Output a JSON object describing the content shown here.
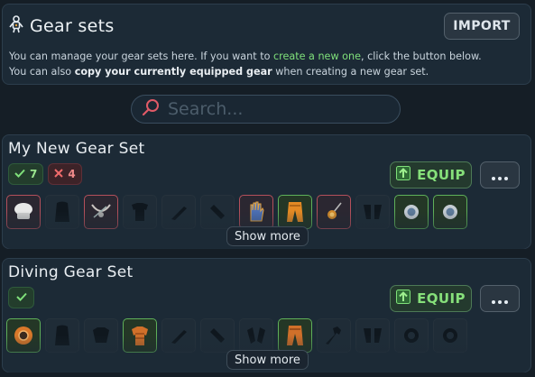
{
  "header": {
    "title": "Gear sets",
    "import_label": "IMPORT",
    "desc_line1_a": "You can manage your gear sets here. If you want to ",
    "desc_line1_link": "create a new one",
    "desc_line1_b": ", click the button below.",
    "desc_line2_a": "You can also ",
    "desc_line2_bold": "copy your currently equipped gear",
    "desc_line2_b": " when creating a new gear set."
  },
  "search": {
    "placeholder": "Search..."
  },
  "gear_sets": [
    {
      "name": "My New Gear Set",
      "ok_count": "7",
      "bad_count": "4",
      "equip_label": "EQUIP",
      "show_more_label": "Show more",
      "slots": [
        "red",
        "empty",
        "red",
        "empty",
        "empty",
        "empty",
        "red",
        "green",
        "red",
        "empty",
        "green",
        "green"
      ]
    },
    {
      "name": "Diving Gear Set",
      "equip_label": "EQUIP",
      "show_more_label": "Show more",
      "slots": [
        "green",
        "empty",
        "empty",
        "green",
        "empty",
        "empty",
        "empty",
        "green",
        "empty",
        "empty",
        "empty",
        "empty"
      ]
    }
  ],
  "colors": {
    "accent_green": "#86e07a",
    "error_red": "#f08a8a",
    "panel_bg": "#1c2a36"
  }
}
